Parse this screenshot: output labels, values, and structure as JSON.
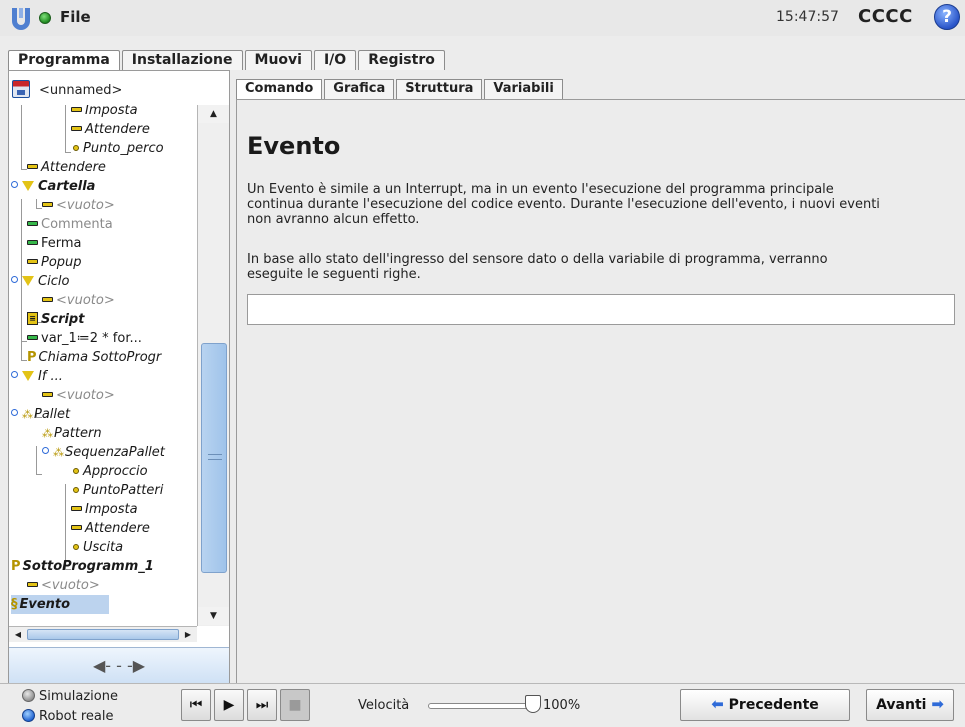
{
  "topbar": {
    "file_label": "File",
    "time": "15:47:57",
    "robot_name": "CCCC",
    "help_label": "?"
  },
  "main_tabs": [
    "Programma",
    "Installazione",
    "Muovi",
    "I/O",
    "Registro"
  ],
  "left": {
    "program_name": "<unnamed>",
    "tree": [
      {
        "label": "Imposta",
        "icon": "line-icon"
      },
      {
        "label": "Attendere",
        "icon": "line-icon"
      },
      {
        "label": "Punto_perco",
        "icon": "dot-icon"
      },
      {
        "label": "Attendere",
        "icon": "line-icon"
      },
      {
        "label": "Cartella",
        "icon": "triangle-icon"
      },
      {
        "label": "<vuoto>",
        "icon": "line-icon"
      },
      {
        "label": "Commenta",
        "icon": "line-icon"
      },
      {
        "label": "Ferma",
        "icon": "line-icon"
      },
      {
        "label": "Popup",
        "icon": "line-icon"
      },
      {
        "label": "Ciclo",
        "icon": "triangle-icon"
      },
      {
        "label": "<vuoto>",
        "icon": "line-icon"
      },
      {
        "label": "Script",
        "icon": "script-icon"
      },
      {
        "label": "var_1≔2 * for...",
        "icon": "line-icon"
      },
      {
        "label": "Chiama SottoProgr",
        "icon": "subprogram-icon"
      },
      {
        "label": "If ...",
        "icon": "triangle-icon"
      },
      {
        "label": "<vuoto>",
        "icon": "line-icon"
      },
      {
        "label": "Pallet",
        "icon": "pallet-icon"
      },
      {
        "label": "Pattern",
        "icon": "pallet-icon"
      },
      {
        "label": "SequenzaPallet",
        "icon": "pallet-icon"
      },
      {
        "label": "Approccio",
        "icon": "dot-icon"
      },
      {
        "label": "PuntoPatteri",
        "icon": "dot-icon"
      },
      {
        "label": "Imposta",
        "icon": "line-icon"
      },
      {
        "label": "Attendere",
        "icon": "line-icon"
      },
      {
        "label": "Uscita",
        "icon": "dot-icon"
      },
      {
        "label": "SottoProgramm_1",
        "icon": "subprogram-icon"
      },
      {
        "label": "<vuoto>",
        "icon": "line-icon"
      },
      {
        "label": "Evento",
        "icon": "event-icon"
      }
    ]
  },
  "sub_tabs": [
    "Comando",
    "Grafica",
    "Struttura",
    "Variabili"
  ],
  "content": {
    "title": "Evento",
    "paragraph1": "Un Evento è simile a un Interrupt, ma in un evento l'esecuzione del programma principale continua durante l'esecuzione del codice evento. Durante l'esecuzione dell'evento, i nuovi eventi non avranno alcun effetto.",
    "paragraph2": "In base allo stato dell'ingresso del sensore dato o della variabile di programma, verranno eseguite le seguenti righe.",
    "expression_value": ""
  },
  "footer": {
    "simulation_label": "Simulazione",
    "real_robot_label": "Robot reale",
    "speed_label": "Velocità",
    "speed_value": "100%",
    "speed_fraction": 1.0,
    "prev_label": "Precedente",
    "next_label": "Avanti"
  },
  "colors": {
    "accent_blue": "#2f6bd8",
    "icon_yellow": "#e3c316",
    "selection": "#bcd3ee"
  }
}
